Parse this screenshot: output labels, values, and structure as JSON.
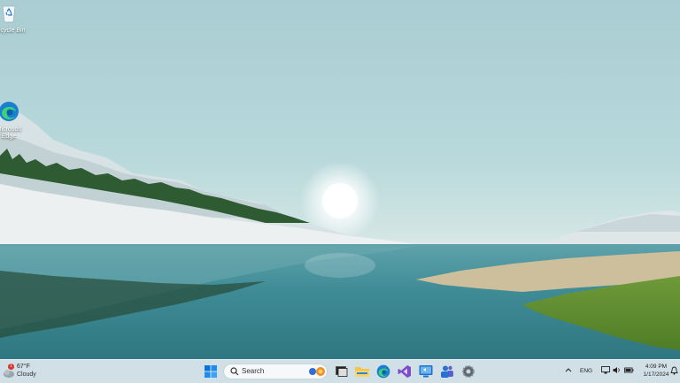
{
  "desktop": {
    "icons": [
      {
        "label": "Recycle Bin",
        "icon": "recycle-bin-icon"
      },
      {
        "label": "Microsoft Edge",
        "icon": "edge-icon"
      }
    ]
  },
  "taskbar": {
    "weather": {
      "temperature": "67°F",
      "condition": "Cloudy",
      "badge_count": "1"
    },
    "search": {
      "placeholder": "Search"
    },
    "pinned_apps": [
      "start-icon",
      "search-icon",
      "copilot-icon",
      "task-view-icon",
      "file-explorer-icon",
      "edge-icon",
      "visual-studio-icon",
      "remote-desktop-icon",
      "teams-icon",
      "settings-icon"
    ],
    "tray": {
      "language": "ENG",
      "time": "4:09 PM",
      "date": "1/17/2024"
    }
  },
  "colors": {
    "sky": "#a9cdd2",
    "water": "#3f8c96",
    "taskbar": "#cedde4",
    "accent": "#0078d4"
  }
}
